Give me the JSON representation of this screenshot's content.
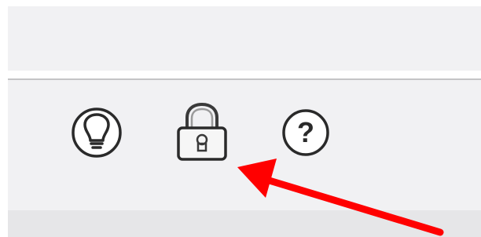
{
  "toolbar": {
    "buttons": [
      {
        "icon": "lightbulb-icon"
      },
      {
        "icon": "lock-icon"
      },
      {
        "icon": "help-icon",
        "glyph": "?"
      }
    ]
  },
  "annotation": {
    "color": "#ff0000",
    "points_to": "lock-icon"
  },
  "colors": {
    "toolbar_background": "#f1f1f3",
    "icon_stroke": "#2a2a2a"
  }
}
